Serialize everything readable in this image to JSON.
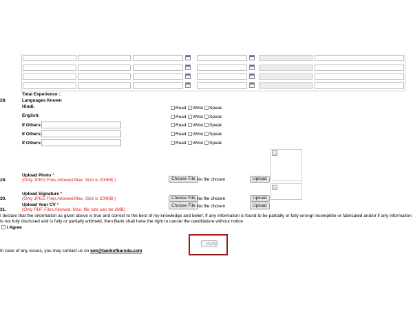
{
  "experience_table": {
    "rows": 4
  },
  "total_experience_label": "Total Experience :",
  "languages": {
    "number": "28.",
    "heading": "Languages Known",
    "rows": [
      {
        "label": "Hindi:",
        "has_input": false
      },
      {
        "label": "English:",
        "has_input": false
      },
      {
        "label": "If Others:",
        "has_input": true
      },
      {
        "label": "If Others:",
        "has_input": true
      },
      {
        "label": "If Others:",
        "has_input": true
      }
    ],
    "options": [
      "Read",
      "Write",
      "Speak"
    ]
  },
  "uploads": {
    "photo": {
      "number": "29.",
      "label": "Upload Photo",
      "required": "*",
      "hint": "(Only JPEG Files Allowed.Max. Size is 200KB.)",
      "choose": "Choose File",
      "status": "No file chosen",
      "upload": "Upload"
    },
    "signature": {
      "number": "30.",
      "label": "Upload Signature",
      "required": "*",
      "hint": "(Only JPEG Files Allowed.Max. Size is 200KB.)",
      "choose": "Choose File",
      "status": "No file chosen",
      "upload": "Upload"
    },
    "cv": {
      "number": "31.",
      "label": "Upload Your CV",
      "required": "*",
      "hint": "(Only PDF Files Allowed. Max. file size can be 2MB)",
      "choose": "Choose File",
      "status": "No file chosen",
      "upload": "Upload"
    }
  },
  "declaration": "I declare that the information as given above is true and correct to the best of my knowledge and belief. If any information is found to be partially or fully wrong/ incomplete or fabricated and/or if any information is not fully disclosed and is fully or partially withheld, then Bank shall have the right to cancel the candidature without notice",
  "agree_label": "I Agree",
  "verify_label": "Verify",
  "contact": {
    "prefix": "In case of any issues, you may contact us on ",
    "email": "wm@bankofbaroda.com"
  }
}
